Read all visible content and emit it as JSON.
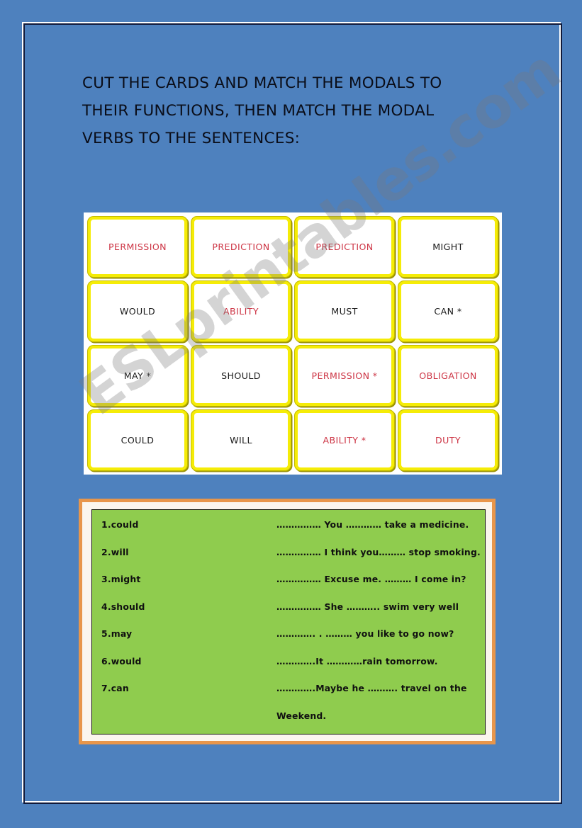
{
  "page": {
    "background_color": "#4E81BE",
    "frame_outer_color": "#FFFFFF",
    "frame_inner_color": "#10193A",
    "watermark": "ESLprintables.com"
  },
  "heading": {
    "line1": "CUT THE CARDS AND MATCH THE MODALS TO",
    "line2": "THEIR FUNCTIONS, THEN MATCH THE MODAL",
    "line3": "VERBS TO THE SENTENCES:"
  },
  "card_grid": {
    "border_color": "#F5EC07",
    "red_text_color": "#CD3545",
    "black_text_color": "#1A1A1A",
    "cards": [
      {
        "label": "PERMISSION",
        "color": "red"
      },
      {
        "label": "PREDICTION",
        "color": "red"
      },
      {
        "label": "PREDICTION",
        "color": "red"
      },
      {
        "label": "MIGHT",
        "color": "black"
      },
      {
        "label": "WOULD",
        "color": "black"
      },
      {
        "label": "ABILITY",
        "color": "red"
      },
      {
        "label": "MUST",
        "color": "black"
      },
      {
        "label": "CAN *",
        "color": "black"
      },
      {
        "label": "MAY *",
        "color": "black"
      },
      {
        "label": "SHOULD",
        "color": "black"
      },
      {
        "label": "PERMISSION *",
        "color": "red"
      },
      {
        "label": "OBLIGATION",
        "color": "red"
      },
      {
        "label": "COULD",
        "color": "black"
      },
      {
        "label": "WILL",
        "color": "black"
      },
      {
        "label": "ABILITY *",
        "color": "red"
      },
      {
        "label": "DUTY",
        "color": "red"
      }
    ]
  },
  "sentence_panel": {
    "frame_color": "#E8964B",
    "background_color": "#8FCC4E",
    "rows": [
      {
        "number": "1.could",
        "sentence": "…………… You ………… take a medicine."
      },
      {
        "number": "2.will",
        "sentence": "…………… I think you……… stop smoking."
      },
      {
        "number": "3.might",
        "sentence": "…………… Excuse me. ……… I come in?"
      },
      {
        "number": "4.should",
        "sentence": "…………… She ……….. swim very well"
      },
      {
        "number": "5.may",
        "sentence": "…………. . ……… you like to go now?"
      },
      {
        "number": "6.would",
        "sentence": "………….It …………rain tomorrow."
      },
      {
        "number": "7.can",
        "sentence": "………….Maybe he ………. travel on the"
      },
      {
        "number": "",
        "sentence": "Weekend."
      }
    ]
  }
}
